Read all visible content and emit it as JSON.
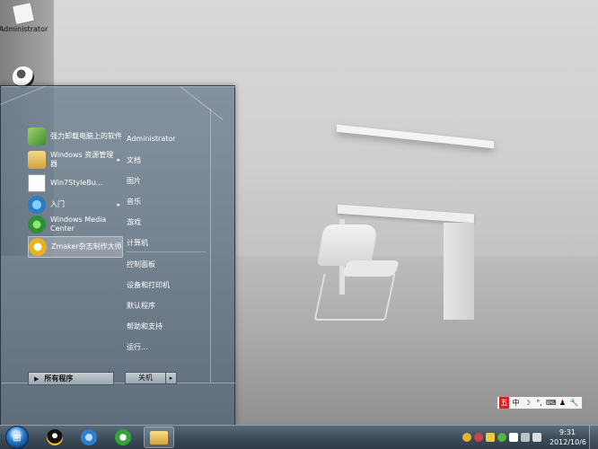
{
  "desktop": {
    "icons": [
      {
        "label": "Administrator",
        "icon": "folder-icon"
      },
      {
        "label": "",
        "icon": "ball-icon"
      }
    ]
  },
  "start_menu": {
    "programs": [
      {
        "label": "强力卸载电脑上的软件",
        "icon": "uninstall-icon",
        "has_submenu": false
      },
      {
        "label": "Windows 资源管理器",
        "icon": "explorer-icon",
        "has_submenu": true
      },
      {
        "label": "Win7StyleBu...",
        "icon": "document-icon",
        "has_submenu": false
      },
      {
        "label": "入门",
        "icon": "getting-started-icon",
        "has_submenu": true
      },
      {
        "label": "Windows Media Center",
        "icon": "media-center-icon",
        "has_submenu": false
      },
      {
        "label": "Zmaker杂志制作大师",
        "icon": "zmaker-icon",
        "has_submenu": false,
        "active": true
      }
    ],
    "all_programs": "所有程序",
    "right_items": [
      "Administrator",
      "文档",
      "图片",
      "音乐",
      "游戏",
      "计算机",
      "控制面板",
      "设备和打印机",
      "默认程序",
      "帮助和支持",
      "运行..."
    ],
    "shutdown_label": "关机",
    "shutdown_arrow": "▸"
  },
  "language_bar": {
    "items": [
      "五",
      "中",
      "☽",
      "°,",
      "⌨",
      "♟",
      "🔧"
    ]
  },
  "taskbar": {
    "start_glyph": "⊞",
    "pinned": [
      {
        "name": "qq",
        "icon": "qq-icon"
      },
      {
        "name": "internet-explorer",
        "icon": "ie-icon"
      },
      {
        "name": "360-browser",
        "icon": "browser-360-icon"
      },
      {
        "name": "windows-explorer",
        "icon": "folder-icon",
        "active": true
      }
    ],
    "clock_time": "9:31",
    "clock_date": "2012/10/6"
  },
  "colors": {
    "taskbar_top": "#5a6b7b",
    "taskbar_bottom": "#2f3b47",
    "menu_glass": "#6e8091"
  }
}
